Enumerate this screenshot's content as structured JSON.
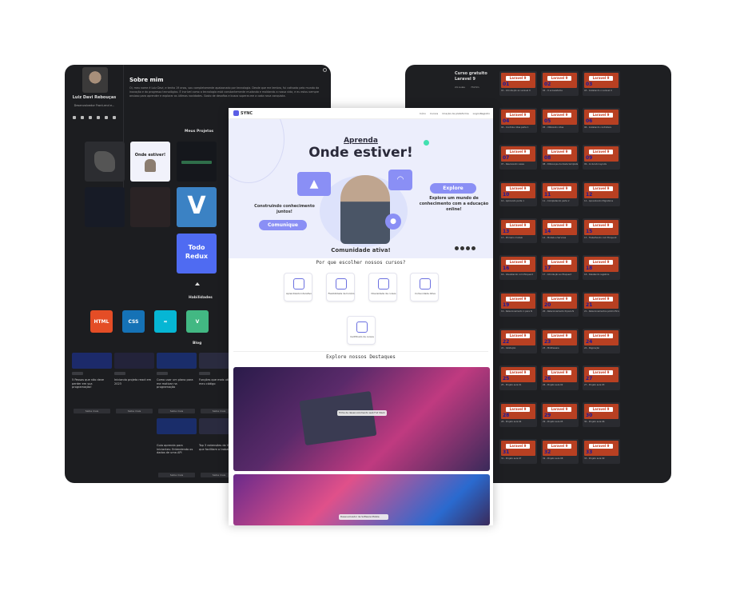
{
  "left": {
    "profile": {
      "name": "Luiz Davi Rebouças",
      "role": "Desenvolvedor Front-end e..."
    },
    "about": {
      "title": "Sobre mim",
      "text": "Oi, meu nome é Luiz Davi, e tenho 19 anos, sou completamente apaixonado por tecnologia. Desde que me lembro, fui cativado pelo mundo da inovação e do progresso tecnológico. É incrível como a tecnologia está constantemente mudando e moldando a nossa vida, e eu estou sempre ansioso para aprender e explorar as últimas novidades. Gosto de desafios e busco superar-me a cada nova conquista."
    },
    "projects_title": "Meus Projetos",
    "project_card_title": "Onde estiver!",
    "todo_label": "Todo Redux",
    "skills_title": "Habilidades",
    "skills": [
      {
        "label": "HTML",
        "color": "#e44d26"
      },
      {
        "label": "CSS",
        "color": "#1572b6"
      },
      {
        "label": "≈",
        "color": "#06b6d4"
      },
      {
        "label": "V",
        "color": "#42b883"
      }
    ],
    "blog_title": "Blog",
    "blog": [
      {
        "title": "5 Passos que não deve perder em sua programação!",
        "btn": "Saiba mais"
      },
      {
        "title": "Iniciando projeto react em 2023",
        "btn": "Saiba mais"
      },
      {
        "title": "Como usar um plano para me motivar na programação",
        "btn": "Saiba mais"
      },
      {
        "title": "Funções que mais utilizo no meu código",
        "btn": "Saiba mais"
      }
    ],
    "blog2": [
      {
        "title": "Guia aprenda para iniciantes: Entendendo os dados de uma API",
        "btn": "Saiba mais"
      },
      {
        "title": "Top 3 extensões do VS code que facilitam o trabalho",
        "btn": "Saiba mais"
      }
    ]
  },
  "center": {
    "logo": "SYNC",
    "menu": [
      "Início",
      "Cursos",
      "Criação de plataforma",
      "Login/Registro"
    ],
    "hero": {
      "aprenda": "Aprenda",
      "headline": "Onde estiver!",
      "left_text": "Construindo conhecimento juntos!",
      "left_btn": "Comunique",
      "right_btn": "Explore",
      "right_text": "Explore um mundo de conhecimento com a educação online!",
      "community": "Comunidade ativa!"
    },
    "why_title": "Por que escolher nossos cursos?",
    "features": [
      "Aprendizado Interativo",
      "Flexibilidade de horário",
      "Diversidade de cursos",
      "Comunidade Ativa",
      "Certificado de cursos"
    ],
    "highlights_title": "Explore nossos Destaques",
    "tooltip1": "Trilha de desenvolvimento web Full Stack",
    "tooltip2": "Desenvolvedor de Software Mobile"
  },
  "right": {
    "course": {
      "label": "Curso gratuito",
      "name": "Laravel 9",
      "lessons": "24 Aulas",
      "duration": "7h15m"
    },
    "lesson_label": "Laravel 9",
    "lessons": [
      {
        "n": "01",
        "t": "01 - Introdução ao Laravel 9"
      },
      {
        "n": "02",
        "t": "02 - O ecossistema"
      },
      {
        "n": "03",
        "t": "03 - Instalando o Laravel 9"
      },
      {
        "n": "04",
        "t": "04 - Controle rotas parte 1"
      },
      {
        "n": "05",
        "t": "05 - Utilizando rotas"
      },
      {
        "n": "06",
        "t": "06 - Instalando controllers"
      },
      {
        "n": "07",
        "t": "07 - Resolvendo views"
      },
      {
        "n": "08",
        "t": "08 - Diferenças de blade templates"
      },
      {
        "n": "09",
        "t": "09 - Incluindo layouts"
      },
      {
        "n": "10",
        "t": "10 - Aplicando parte 1"
      },
      {
        "n": "11",
        "t": "11 - Completando parte 2"
      },
      {
        "n": "12",
        "t": "12 - Aprendendo Migrations"
      },
      {
        "n": "13",
        "t": "13 - Primeiro modelo"
      },
      {
        "n": "14",
        "t": "14 - Models e Services"
      },
      {
        "n": "15",
        "t": "15 - Trabalhando com Eloquent"
      },
      {
        "n": "16",
        "t": "16 - Atualizando com Eloquent"
      },
      {
        "n": "17",
        "t": "17 - Introdução ao Eloquent"
      },
      {
        "n": "18",
        "t": "18 - Deletando registros"
      },
      {
        "n": "19",
        "t": "19 - Relacionamento 1 para N"
      },
      {
        "n": "20",
        "t": "20 - Relacionamento N para N"
      },
      {
        "n": "21",
        "t": "21 - Relacionamentos polimórficos"
      },
      {
        "n": "22",
        "t": "22 - Validação"
      },
      {
        "n": "23",
        "t": "23 - Middleware"
      },
      {
        "n": "24",
        "t": "24 - Paginação"
      },
      {
        "n": "25",
        "t": "25 - Projeto aula 01"
      },
      {
        "n": "26",
        "t": "26 - Projeto aula 02"
      },
      {
        "n": "27",
        "t": "27 - Projeto aula 03"
      },
      {
        "n": "28",
        "t": "28 - Projeto aula 04"
      },
      {
        "n": "29",
        "t": "29 - Projeto aula 05"
      },
      {
        "n": "30",
        "t": "30 - Projeto aula 06"
      },
      {
        "n": "31",
        "t": "31 - Projeto aula 07"
      },
      {
        "n": "32",
        "t": "32 - Projeto aula 08"
      },
      {
        "n": "33",
        "t": "33 - Projeto aula 09"
      }
    ]
  }
}
